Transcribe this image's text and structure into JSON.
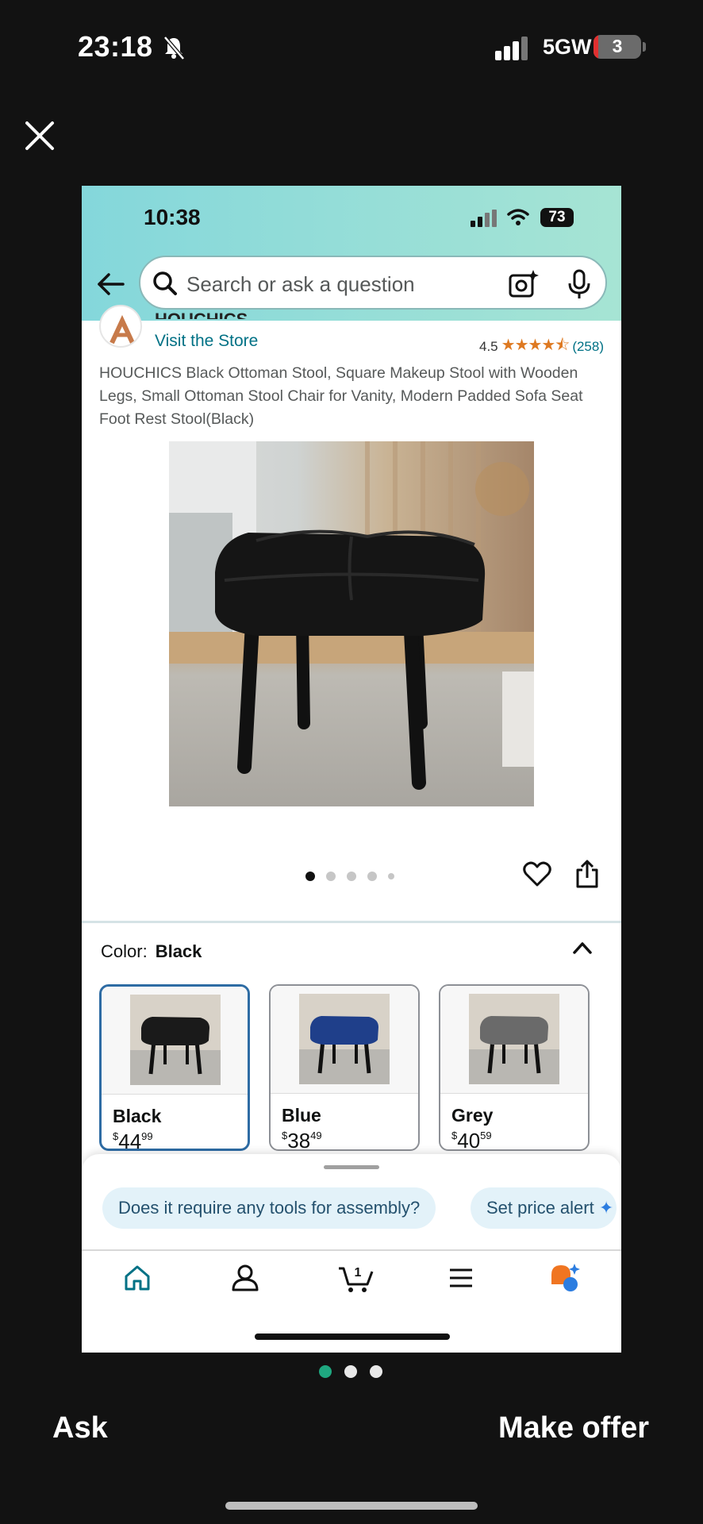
{
  "outer_status": {
    "time": "23:18",
    "network": "5GW",
    "battery": "3"
  },
  "inner_status": {
    "time": "10:38",
    "battery": "73"
  },
  "search": {
    "placeholder": "Search or ask a question"
  },
  "brand": {
    "name": "HOUCHICS",
    "visit_store": "Visit the Store"
  },
  "rating": {
    "value": "4.5",
    "stars": 4.5,
    "count": "(258)"
  },
  "product": {
    "title": "HOUCHICS Black Ottoman Stool, Square Makeup Stool with Wooden Legs, Small Ottoman Stool Chair for Vanity, Modern Padded Sofa Seat Foot Rest Stool(Black)"
  },
  "image_carousel": {
    "count": 5,
    "active": 0
  },
  "color": {
    "label": "Color:",
    "selected": "Black"
  },
  "swatches": [
    {
      "name": "Black",
      "currency": "$",
      "price_whole": "44",
      "price_fraction": "99",
      "color": "#1a1a1a"
    },
    {
      "name": "Blue",
      "currency": "$",
      "price_whole": "38",
      "price_fraction": "49",
      "color": "#1f3f8a"
    },
    {
      "name": "Grey",
      "currency": "$",
      "price_whole": "40",
      "price_fraction": "59",
      "color": "#6a6a6a"
    }
  ],
  "chips": [
    "Does it require any tools for assembly?",
    "Set price alert"
  ],
  "cart_count": "1",
  "pager": {
    "count": 3,
    "active": 0
  },
  "actions": {
    "ask": "Ask",
    "make_offer": "Make offer"
  },
  "colors": {
    "accent_teal": "#007185",
    "star": "#de7921",
    "selected_border": "#2e6ca4",
    "pager_active": "#1fa880"
  }
}
